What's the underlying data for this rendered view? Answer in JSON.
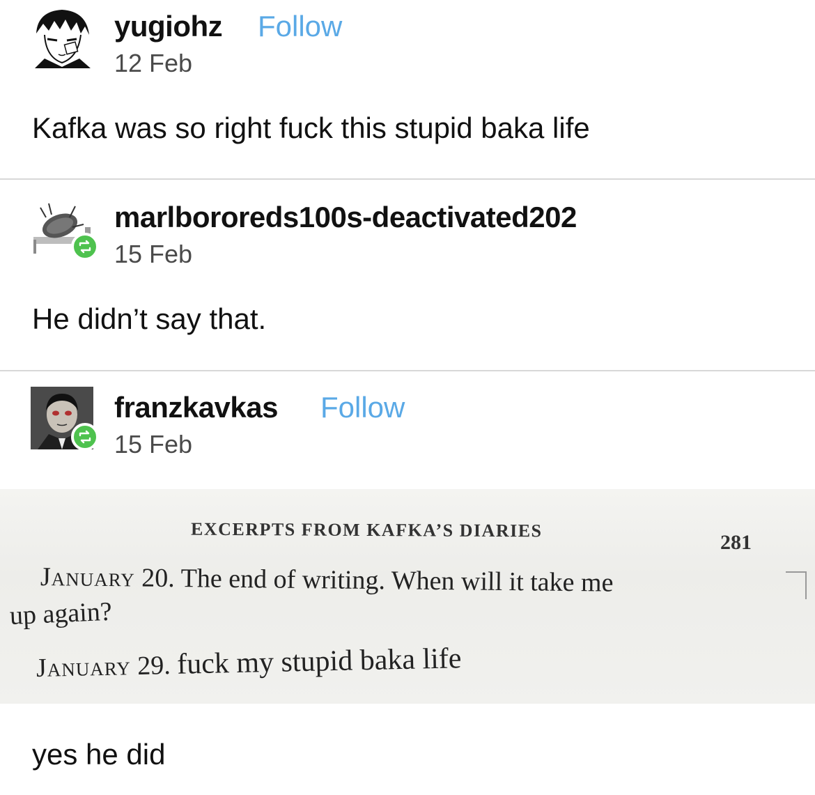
{
  "posts": [
    {
      "username": "yugiohz",
      "follow_label": "Follow",
      "date": "12 Feb",
      "body": "Kafka was so right fuck this stupid baka life",
      "avatar_icon": "manga-avatar",
      "reblog": false
    },
    {
      "username": "marlbororeds100s-deactivated202",
      "date": "15 Feb",
      "body": "He didn’t say that.",
      "avatar_icon": "bug-on-bed-avatar",
      "reblog": true
    },
    {
      "username": "franzkavkas",
      "follow_label": "Follow",
      "date": "15 Feb",
      "body": "yes he did",
      "avatar_icon": "kafka-portrait-avatar",
      "reblog": true
    }
  ],
  "diary": {
    "running_head": "EXCERPTS FROM KAFKA’S DIARIES",
    "page_number": "281",
    "entry1_date": "January",
    "entry1_day": "20.",
    "entry1_text_line1": "The end of writing. When will it take me",
    "entry1_text_line2": "up again?",
    "entry2_date": "January",
    "entry2_day": "29.",
    "entry2_text": "fuck my stupid baka life"
  },
  "colors": {
    "follow": "#5aa9e6",
    "reblog_badge": "#4ec24e",
    "divider": "#d8d8d8"
  }
}
